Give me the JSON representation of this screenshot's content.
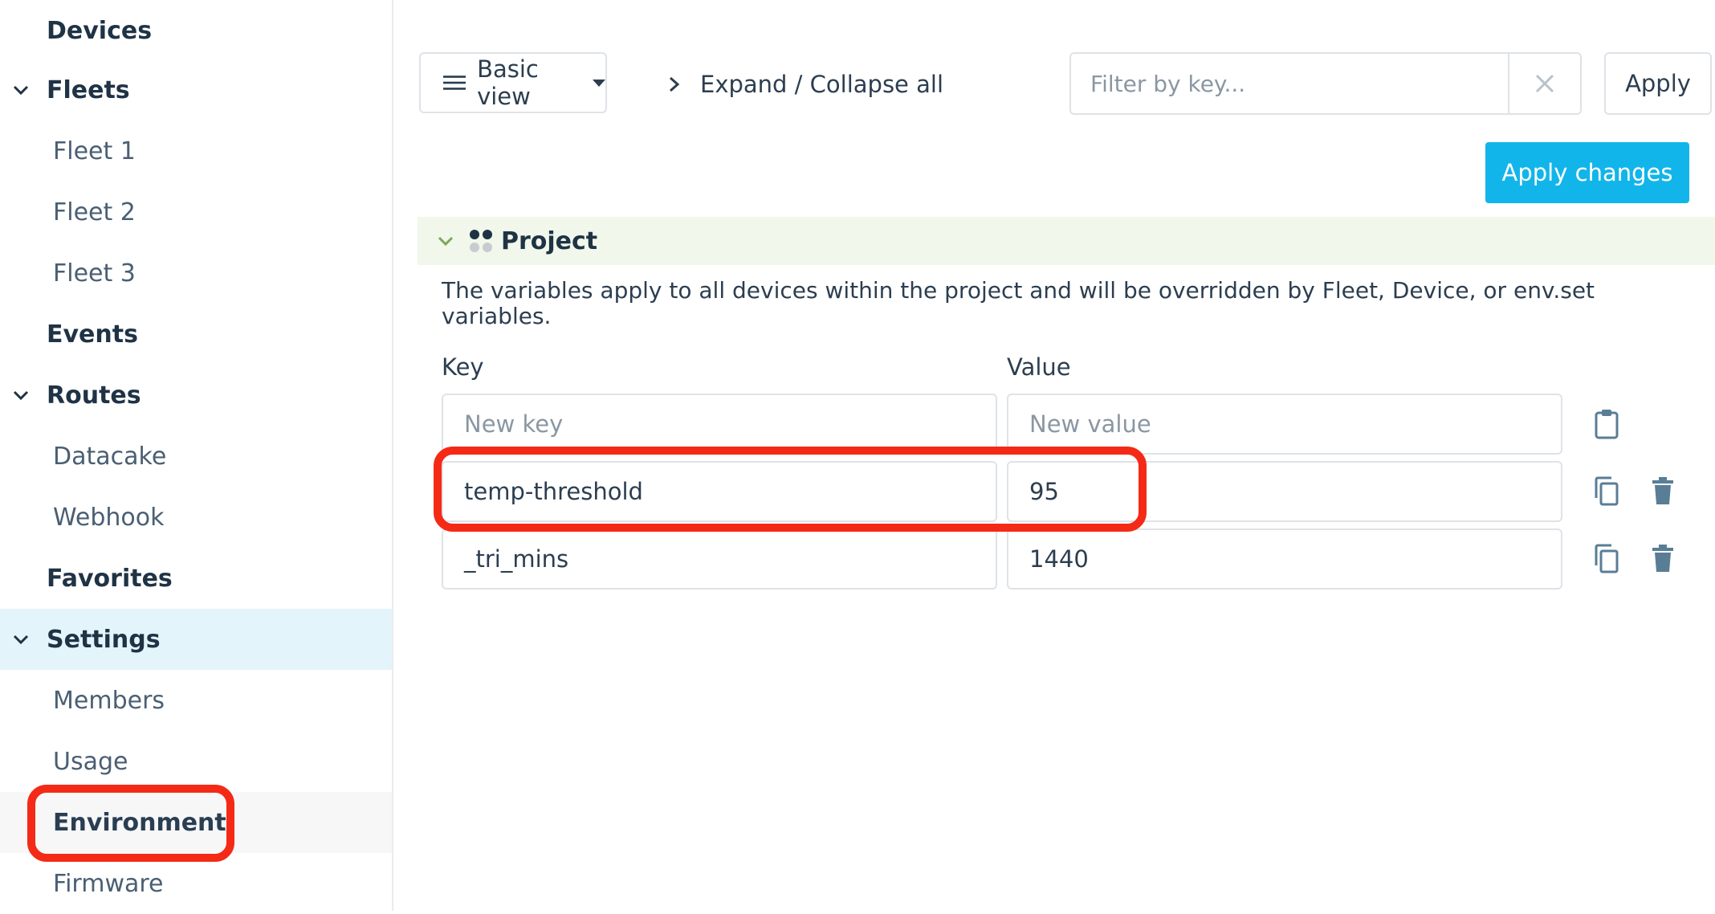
{
  "sidebar": {
    "items": [
      {
        "label": "Devices",
        "level": "top",
        "expandable": false
      },
      {
        "label": "Fleets",
        "level": "top",
        "expandable": true
      },
      {
        "label": "Fleet 1",
        "level": "sub"
      },
      {
        "label": "Fleet 2",
        "level": "sub"
      },
      {
        "label": "Fleet 3",
        "level": "sub"
      },
      {
        "label": "Events",
        "level": "top",
        "expandable": false
      },
      {
        "label": "Routes",
        "level": "top",
        "expandable": true
      },
      {
        "label": "Datacake",
        "level": "sub"
      },
      {
        "label": "Webhook",
        "level": "sub"
      },
      {
        "label": "Favorites",
        "level": "top",
        "expandable": false
      },
      {
        "label": "Settings",
        "level": "top",
        "expandable": true,
        "active": true
      },
      {
        "label": "Members",
        "level": "sub"
      },
      {
        "label": "Usage",
        "level": "sub"
      },
      {
        "label": "Environment",
        "level": "sub",
        "highlighted": true
      },
      {
        "label": "Firmware",
        "level": "sub"
      }
    ]
  },
  "toolbar": {
    "view_label": "Basic view",
    "expand_label": "Expand / Collapse all",
    "filter_placeholder": "Filter by key...",
    "apply_label": "Apply",
    "apply_changes_label": "Apply changes"
  },
  "section": {
    "title": "Project",
    "description": "The variables apply to all devices within the project and will be overridden by Fleet, Device, or env.set variables.",
    "key_header": "Key",
    "value_header": "Value",
    "new_key_placeholder": "New key",
    "new_value_placeholder": "New value",
    "rows": [
      {
        "key": "temp-threshold",
        "value": "95"
      },
      {
        "key": "_tri_mins",
        "value": "1440"
      }
    ]
  },
  "colors": {
    "accent": "#12b5ea",
    "highlight": "#f42a16",
    "active_bg": "#e4f4fb",
    "section_bg": "#f1f7ea",
    "icon": "#5a7d96"
  },
  "icons": [
    "chevron-down-icon",
    "menu-icon",
    "caret-down-icon",
    "chevron-right-icon",
    "close-icon",
    "project-dots-icon",
    "clipboard-icon",
    "copy-icon",
    "trash-icon"
  ]
}
